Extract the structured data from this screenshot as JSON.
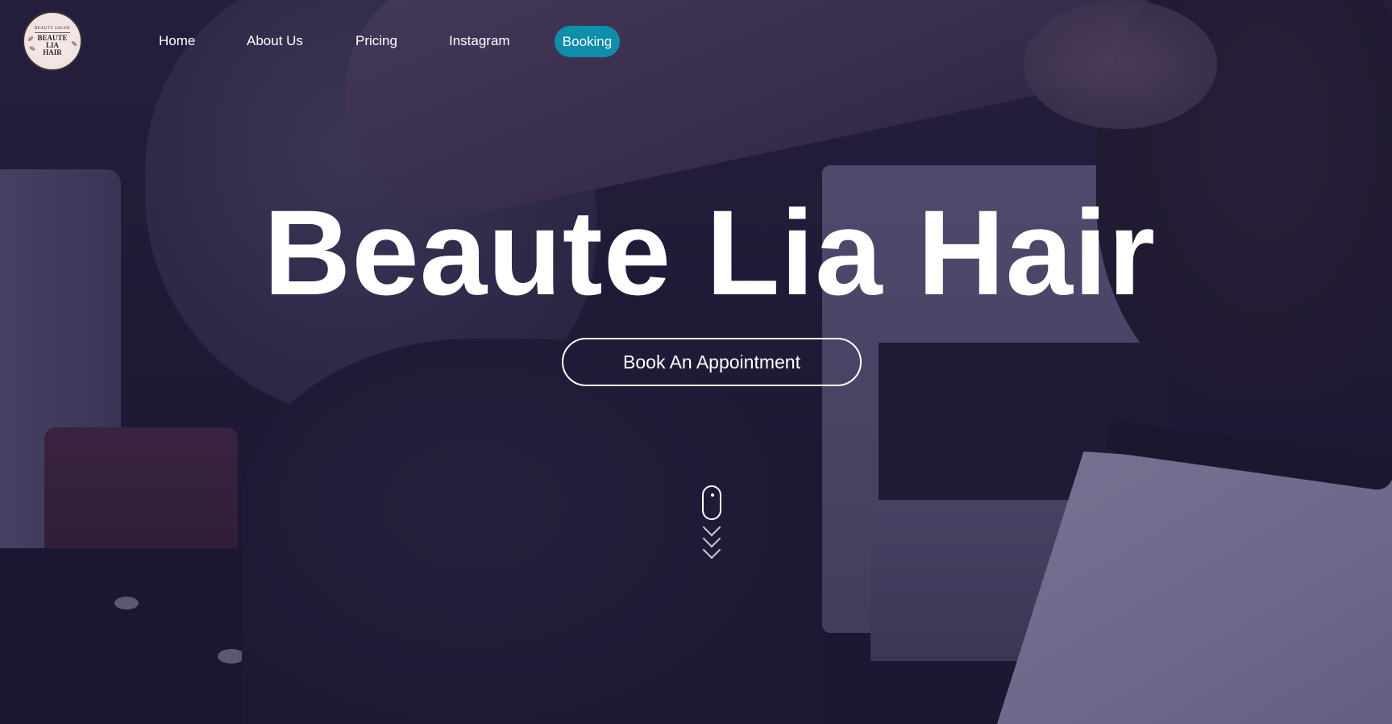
{
  "brand": {
    "logo_top": "BEAUTY SALON",
    "logo_lines": [
      "BEAUTE",
      "LIA",
      "HAIR"
    ]
  },
  "nav": {
    "items": [
      {
        "label": "Home"
      },
      {
        "label": "About Us"
      },
      {
        "label": "Pricing"
      },
      {
        "label": "Instagram"
      },
      {
        "label": "Booking",
        "active": true
      }
    ]
  },
  "hero": {
    "title": "Beaute Lia Hair",
    "cta_label": "Book An Appointment"
  },
  "icons": {
    "scroll": "mouse-icon",
    "scroll_arrows": "chevron-down-icon"
  },
  "colors": {
    "accent": "#0e8eab",
    "overlay": "#1e1838",
    "text": "#ffffff"
  }
}
